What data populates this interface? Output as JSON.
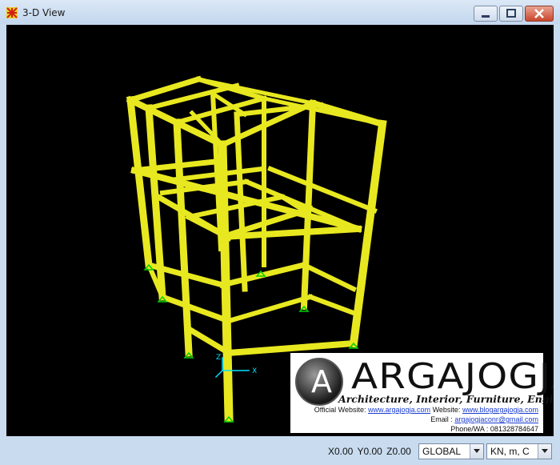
{
  "window": {
    "title": "3-D View",
    "icon": "structure-app-icon"
  },
  "title_controls": [
    "minimize",
    "maximize",
    "close"
  ],
  "viewport": {
    "background": "#000000",
    "frame_color": "#e8e820",
    "support_color": "#00d000",
    "axis_color": "#00e0ff"
  },
  "axes": {
    "x": "X",
    "z": "Z"
  },
  "overlay": {
    "letter": "A",
    "brand": "ARGAJOGJA",
    "tagline": "Architecture, Interior, Furniture, Engineering",
    "website_label": "Official Website:",
    "website": "www.argajogja.com",
    "website2_label": "Website:",
    "website2": "www.blogargajogja.com",
    "email_label": "Email :",
    "email": "argajogjaconr@gmail.com",
    "phone": "Phone/WA : 081328784647"
  },
  "status": {
    "coords": "X0.00  Y0.00  Z0.00",
    "coord_system": "GLOBAL",
    "units": "KN, m, C"
  }
}
